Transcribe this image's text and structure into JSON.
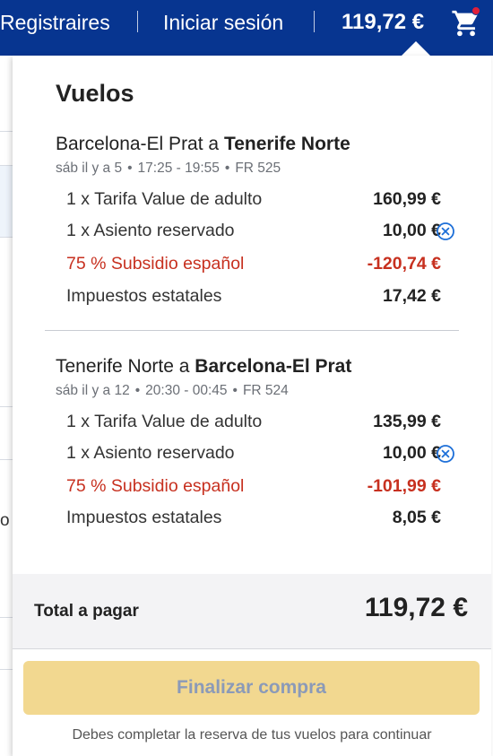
{
  "header": {
    "register_label": "Registraires",
    "login_label": "Iniciar sesión",
    "cart_total": "119,72 €",
    "cart_icon": "cart-icon",
    "brand_color": "#073590",
    "notification_dot_color": "#e0203a"
  },
  "background_fragment": {
    "letter": "o"
  },
  "summary": {
    "title": "Vuelos",
    "segments": [
      {
        "origin": "Barcelona-El Prat",
        "connector": "a",
        "destination": "Tenerife Norte",
        "date": "sáb il y a 5",
        "times": "17:25 - 19:55",
        "flight": "FR 525",
        "items": [
          {
            "label": "1 x Tarifa Value de adulto",
            "amount": "160,99 €",
            "kind": "normal"
          },
          {
            "label": "1 x Asiento reservado",
            "amount": "10,00 €",
            "kind": "removable"
          },
          {
            "label": "75 % Subsidio español",
            "amount": "-120,74 €",
            "kind": "discount"
          },
          {
            "label": "Impuestos estatales",
            "amount": "17,42 €",
            "kind": "normal"
          }
        ]
      },
      {
        "origin": "Tenerife Norte",
        "connector": "a",
        "destination": "Barcelona-El Prat",
        "date": "sáb il y a 12",
        "times": "20:30 - 00:45",
        "flight": "FR 524",
        "items": [
          {
            "label": "1 x Tarifa Value de adulto",
            "amount": "135,99 €",
            "kind": "normal"
          },
          {
            "label": "1 x Asiento reservado",
            "amount": "10,00 €",
            "kind": "removable"
          },
          {
            "label": "75 % Subsidio español",
            "amount": "-101,99 €",
            "kind": "discount"
          },
          {
            "label": "Impuestos estatales",
            "amount": "8,05 €",
            "kind": "normal"
          }
        ]
      }
    ],
    "total_label": "Total a pagar",
    "total_value": "119,72 €",
    "checkout_label": "Finalizar compra",
    "checkout_note": "Debes completar la reserva de tus vuelos para continuar",
    "discount_color": "#c7301f",
    "button_color": "#f2d890",
    "remove_icon": "remove-circle-icon"
  }
}
